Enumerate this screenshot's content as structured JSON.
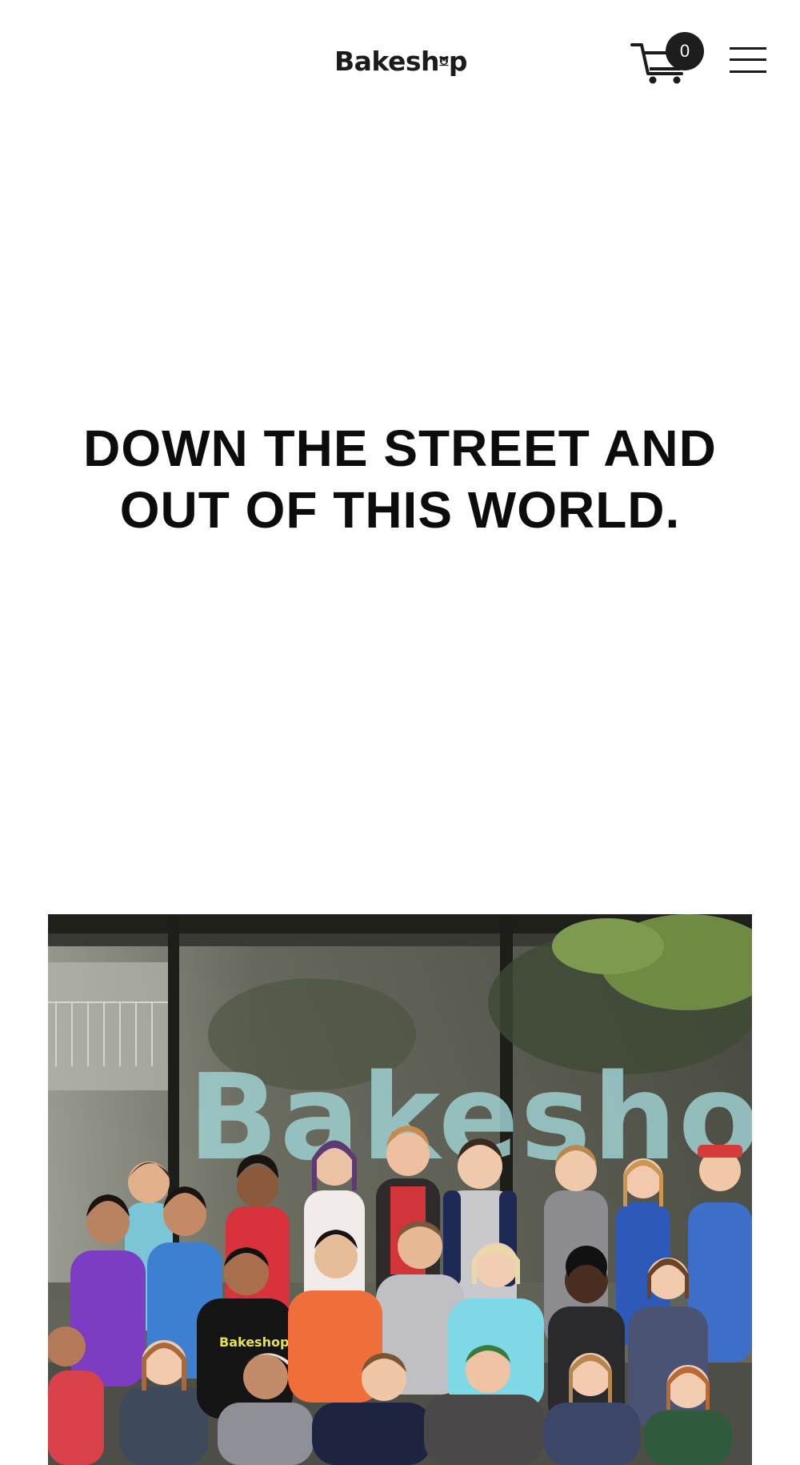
{
  "header": {
    "logo_text": "Bakeshop",
    "logo_prefix": "Bakesh",
    "logo_suffix": "p",
    "cart_count": "0",
    "cart_icon": "cart-icon",
    "menu_icon": "hamburger-menu-icon"
  },
  "hero": {
    "heading": "DOWN THE STREET AND OUT OF THIS WORLD."
  },
  "team_photo": {
    "storefront_sign": "Bakesho",
    "shirt_logo": "Bakeshop"
  },
  "colors": {
    "text": "#111111",
    "background": "#ffffff",
    "badge": "#1d1d1d"
  }
}
